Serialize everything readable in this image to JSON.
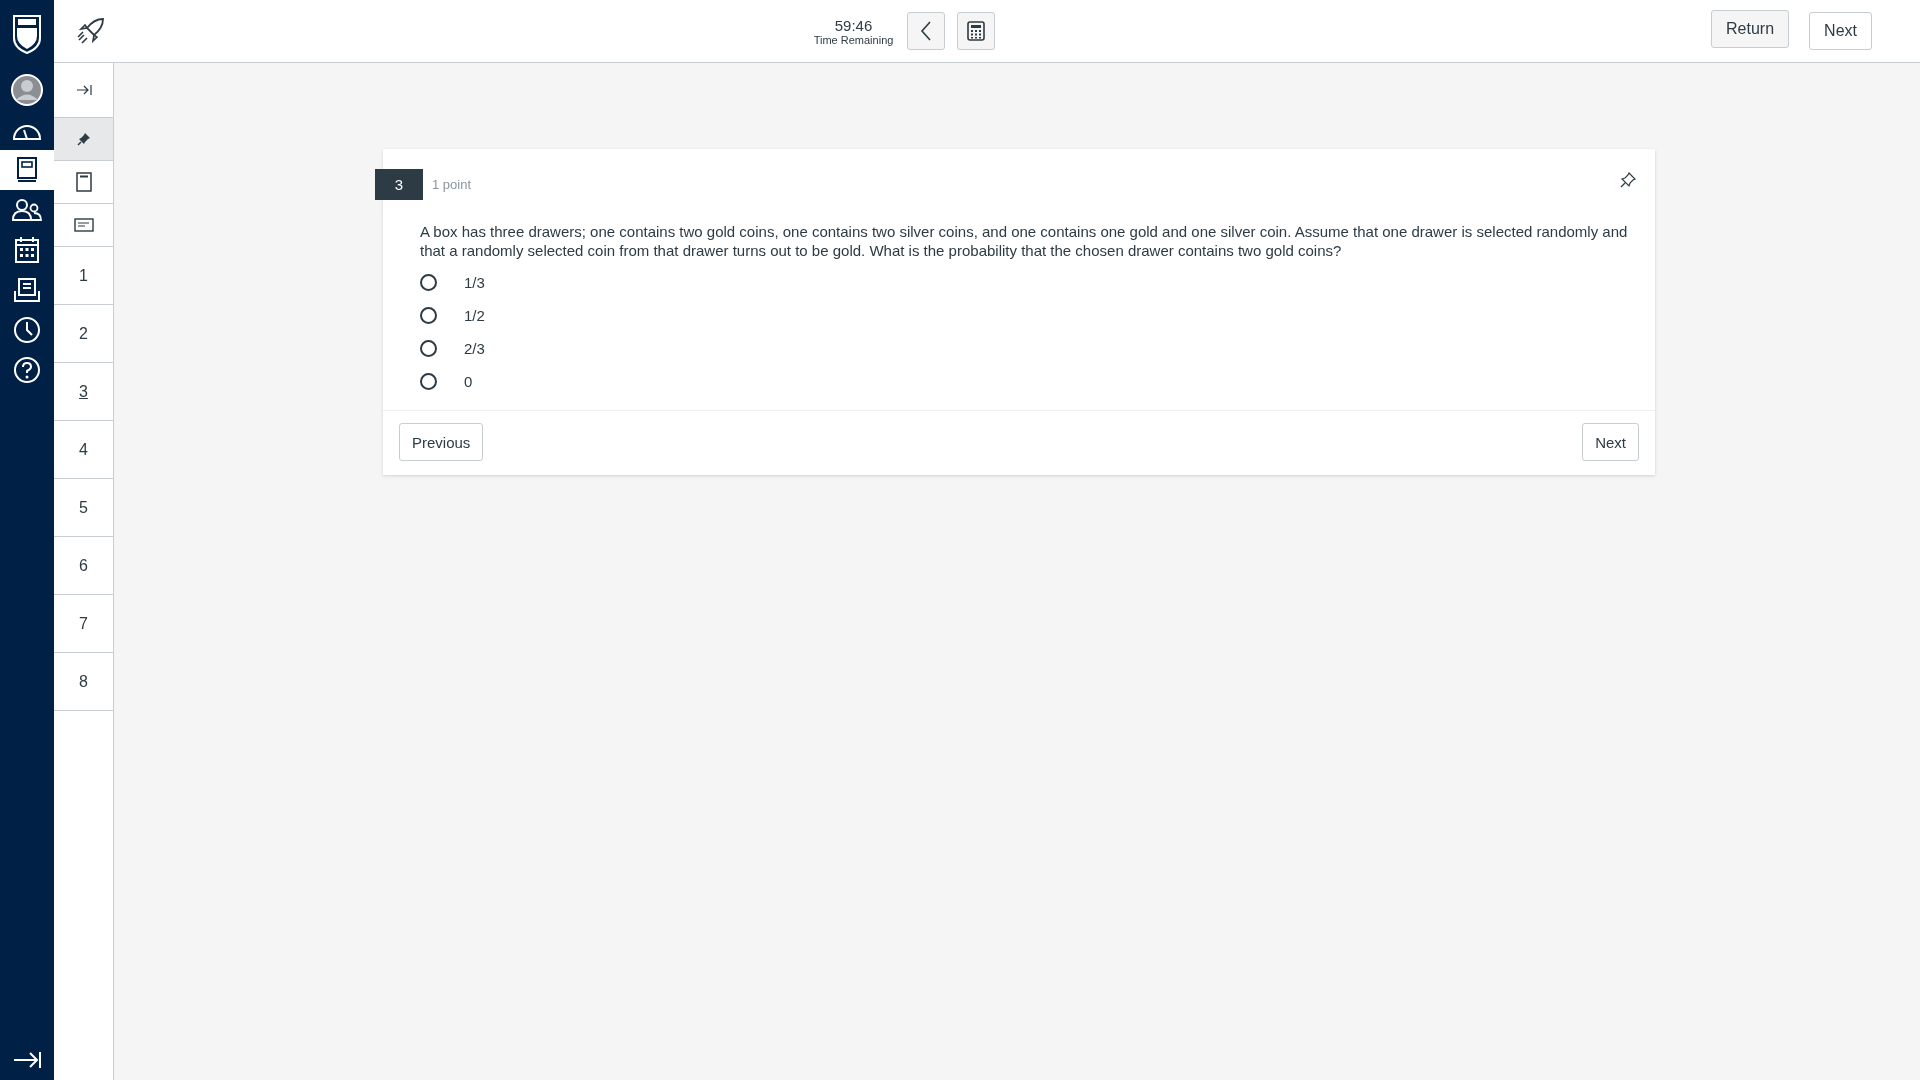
{
  "global_nav": [
    {
      "kind": "account",
      "selected": false
    },
    {
      "kind": "dashboard",
      "selected": false
    },
    {
      "kind": "courses",
      "selected": true
    },
    {
      "kind": "groups",
      "selected": false
    },
    {
      "kind": "calendar",
      "selected": false
    },
    {
      "kind": "inbox",
      "selected": false
    },
    {
      "kind": "history",
      "selected": false
    },
    {
      "kind": "help",
      "selected": false
    }
  ],
  "timer": {
    "time": "59:46",
    "label": "Time Remaining"
  },
  "header_buttons": [
    "Return",
    "Next"
  ],
  "tools": [
    {
      "kind": "collapse",
      "selected": false
    },
    {
      "kind": "pin",
      "selected": true
    },
    {
      "kind": "calculator",
      "selected": false
    },
    {
      "kind": "notes",
      "selected": false
    }
  ],
  "questions": [
    {
      "label": "1",
      "selected": false
    },
    {
      "label": "2",
      "selected": false
    },
    {
      "label": "3",
      "selected": true
    },
    {
      "label": "4",
      "selected": false
    },
    {
      "label": "5",
      "selected": false
    },
    {
      "label": "6",
      "selected": false
    },
    {
      "label": "7",
      "selected": false
    },
    {
      "label": "8",
      "selected": false
    }
  ],
  "question": {
    "number": "3",
    "points": "1 point",
    "text": "A box has three drawers; one contains two gold coins, one contains two silver coins, and one contains one gold and one silver coin. Assume that one drawer is selected randomly and that a randomly selected coin from that drawer turns out to be gold. What is the probability that the chosen drawer contains two gold coins?",
    "options": [
      {
        "label": "1/3",
        "checked": false
      },
      {
        "label": "1/2",
        "checked": false
      },
      {
        "label": "2/3",
        "checked": false
      },
      {
        "label": "0",
        "checked": false
      }
    ]
  },
  "footer_buttons": {
    "previous": "Previous",
    "next": "Next"
  }
}
